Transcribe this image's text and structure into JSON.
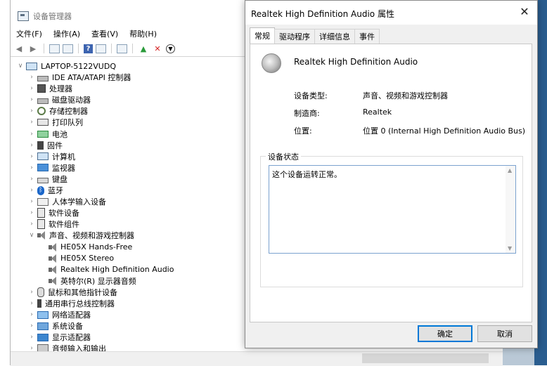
{
  "device_manager": {
    "title": "设备管理器",
    "menu": [
      "文件(F)",
      "操作(A)",
      "查看(V)",
      "帮助(H)"
    ],
    "root": "LAPTOP-5122VUDQ",
    "tree": [
      {
        "label": "IDE ATA/ATAPI 控制器",
        "icon": "drive-icon"
      },
      {
        "label": "处理器",
        "icon": "chip-icon"
      },
      {
        "label": "磁盘驱动器",
        "icon": "drive-icon"
      },
      {
        "label": "存储控制器",
        "icon": "gear-icon"
      },
      {
        "label": "打印队列",
        "icon": "printer-icon"
      },
      {
        "label": "电池",
        "icon": "battery-icon"
      },
      {
        "label": "固件",
        "icon": "firmware-icon"
      },
      {
        "label": "计算机",
        "icon": "computer-icon"
      },
      {
        "label": "监视器",
        "icon": "monitor-icon"
      },
      {
        "label": "键盘",
        "icon": "keyboard-icon"
      },
      {
        "label": "蓝牙",
        "icon": "bluetooth-icon"
      },
      {
        "label": "人体学输入设备",
        "icon": "hid-icon"
      },
      {
        "label": "软件设备",
        "icon": "software-icon"
      },
      {
        "label": "软件组件",
        "icon": "software-icon"
      },
      {
        "label": "声音、视频和游戏控制器",
        "icon": "speaker-icon",
        "expanded": true
      },
      {
        "label": "HE05X Hands-Free",
        "icon": "speaker-icon",
        "child": true
      },
      {
        "label": "HE05X Stereo",
        "icon": "speaker-icon",
        "child": true
      },
      {
        "label": "Realtek High Definition Audio",
        "icon": "speaker-icon",
        "child": true
      },
      {
        "label": "英特尔(R) 显示器音频",
        "icon": "speaker-icon",
        "child": true
      },
      {
        "label": "鼠标和其他指针设备",
        "icon": "mouse-icon"
      },
      {
        "label": "通用串行总线控制器",
        "icon": "usb-icon"
      },
      {
        "label": "网络适配器",
        "icon": "network-icon"
      },
      {
        "label": "系统设备",
        "icon": "system-icon"
      },
      {
        "label": "显示适配器",
        "icon": "display-icon"
      },
      {
        "label": "音频输入和输出",
        "icon": "audio-icon"
      }
    ]
  },
  "dialog": {
    "title": "Realtek High Definition Audio 属性",
    "tabs": [
      "常规",
      "驱动程序",
      "详细信息",
      "事件"
    ],
    "device_name": "Realtek High Definition Audio",
    "props": [
      {
        "label": "设备类型:",
        "value": "声音、视频和游戏控制器"
      },
      {
        "label": "制造商:",
        "value": "Realtek"
      },
      {
        "label": "位置:",
        "value": "位置 0 (Internal High Definition Audio Bus)"
      }
    ],
    "status_group": "设备状态",
    "status_text": "这个设备运转正常。",
    "ok": "确定",
    "cancel": "取消"
  }
}
